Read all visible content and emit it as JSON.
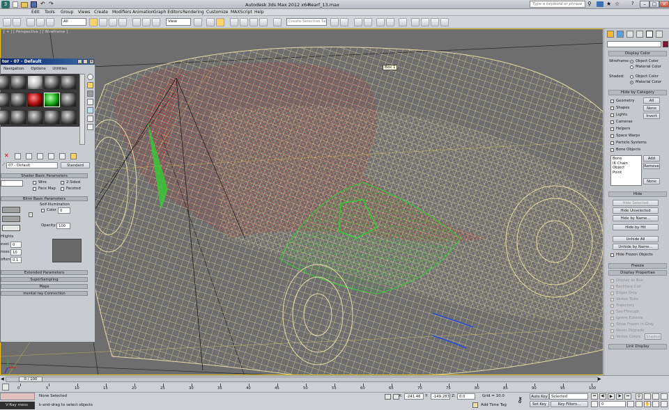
{
  "window": {
    "title": "Autodesk 3ds Max  2012 x64",
    "filename": "Rearf_13.max",
    "search_placeholder": "Type a keyword or phrase"
  },
  "menu": [
    "Edit",
    "Tools",
    "Group",
    "Views",
    "Create",
    "Modifiers",
    "Animation",
    "Graph Editors",
    "Rendering",
    "Customize",
    "MAXScript",
    "Help"
  ],
  "toolbar": {
    "selection_filter": "All",
    "ref_coord": "View",
    "named_selection_placeholder": "Create Selection Se"
  },
  "viewport": {
    "label": "[ + ] [ Perspective ] [ Wireframe ]",
    "tooltip": "Box 1"
  },
  "material_editor": {
    "title": "tor - 07 - Default",
    "menu": [
      "Navigation",
      "Options",
      "Utilities"
    ],
    "material_name": "07 - Default",
    "material_type": "Standard",
    "rollouts": {
      "shader_basic": "Shader Basic Parameters",
      "wire": "Wire",
      "two_sided": "2-Sided",
      "face_map": "Face Map",
      "faceted": "Faceted",
      "blinn_basic": "Blinn Basic Parameters",
      "self_illum": "Self-Illumination",
      "color": "Color",
      "color_value": "0",
      "opacity_label": "Opacity:",
      "opacity_value": "100",
      "highlights": "Hlights",
      "spec_level_label": "evel:",
      "spec_level": "0",
      "gloss_label": "ness:",
      "gloss": "10",
      "soften_label": "often:",
      "soften": "0.1",
      "extended": "Extended Parameters",
      "supersampling": "SuperSampling",
      "maps": "Maps",
      "mental_ray": "mental ray Connection"
    }
  },
  "command_panel": {
    "display_color": {
      "header": "Display Color",
      "wireframe_label": "Wireframe:",
      "shaded_label": "Shaded:",
      "object_color": "Object Color",
      "material_color": "Material Color"
    },
    "hide_by_category": {
      "header": "Hide by Category",
      "items": [
        "Geometry",
        "Shapes",
        "Lights",
        "Cameras",
        "Helpers",
        "Space Warps",
        "Particle Systems",
        "Bone Objects"
      ],
      "buttons": [
        "All",
        "None",
        "Invert"
      ],
      "list": [
        "Bone",
        "IK Chain Object",
        "Point"
      ],
      "add": "Add",
      "remove": "Remove",
      "none": "None"
    },
    "hide": {
      "header": "Hide",
      "buttons": [
        "Hide Selected",
        "Hide Unselected",
        "Hide by Name...",
        "Hide by Hit",
        "Unhide All",
        "Unhide by Name..."
      ],
      "hide_frozen": "Hide Frozen Objects"
    },
    "freeze_header": "Freeze",
    "display_properties": {
      "header": "Display Properties",
      "items": [
        "Display as Box",
        "Backface Cull",
        "Edges Only",
        "Vertex Ticks",
        "Trajectory",
        "See-Through",
        "Ignore Extents",
        "Show Frozen in Gray",
        "Never Degrade",
        "Vertex Colors"
      ],
      "shaded": "Shaded"
    },
    "link_display": "Link Display"
  },
  "trackbar": {
    "time_slider": "0 / 100",
    "ticks": [
      "0",
      "5",
      "10",
      "15",
      "20",
      "25",
      "30",
      "35",
      "40",
      "45",
      "50",
      "55",
      "60",
      "65",
      "70",
      "75",
      "80",
      "85",
      "90",
      "95",
      "100"
    ]
  },
  "status": {
    "maxscript": "V-Ray mess",
    "selection": "None Selected",
    "prompt": "k-and-drag to select objects",
    "x_label": "X:",
    "x": "-241.46",
    "y_label": "Y:",
    "y": "-149.283",
    "z_label": "Z:",
    "z": "0.0",
    "grid": "Grid = 10.0",
    "add_time_tag": "Add Time Tag",
    "auto_key": "Auto Key",
    "auto_key_value": "Selected",
    "set_key": "Set Key",
    "key_filters": "Key Filters...",
    "frame": "0"
  },
  "colors": {
    "viewport_bg": "#6e6e6e",
    "wire_main": "#e8dca4",
    "wire_red": "#c41e1e",
    "wire_green": "#33cc33",
    "wire_blue": "#2a4fd0",
    "active_border": "#f2c21a"
  }
}
